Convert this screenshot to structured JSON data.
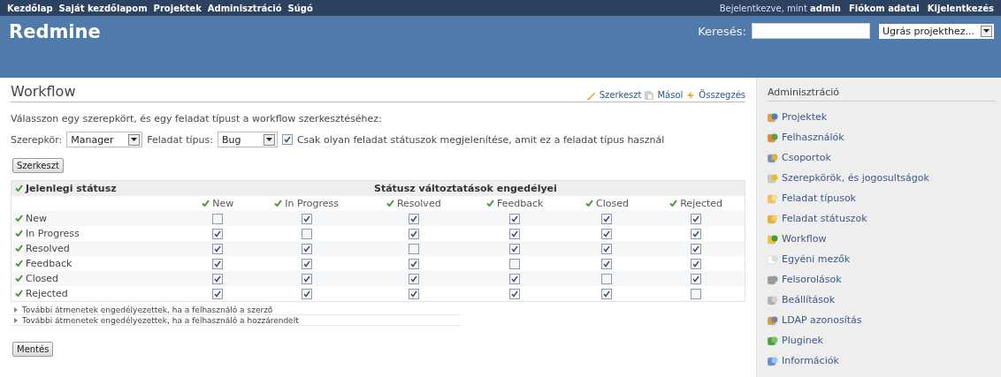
{
  "top_menu": {
    "items": [
      "Kezdőlap",
      "Saját kezdőlapom",
      "Projektek",
      "Adminisztráció",
      "Súgó"
    ],
    "logged_in": "Bejelentkezve, mint **admin**",
    "account_links": [
      "Fiókom adatai",
      "Kijelentkezés"
    ]
  },
  "header": {
    "title": "Redmine",
    "search_label": "Keresés:",
    "jump_select": "Ugrás projekthez..."
  },
  "content": {
    "title": "Workflow",
    "actions": [
      "Szerkeszt",
      "Másol",
      "Összegzés"
    ],
    "intro": "Válasszon egy szerepkört, és egy feladat típust a workflow szerkesztéséhez:",
    "role_label": "Szerepkör:",
    "role_value": "Manager",
    "tracker_label": "Feladat típus:",
    "tracker_value": "Bug",
    "used_only": {
      "label": "Csak olyan feladat státuszok megjelenítése, amit ez a feladat típus használ",
      "checked": true
    },
    "edit_button": "Szerkeszt",
    "table": {
      "current_header": "Jelenlegi státusz",
      "allowed_header": "Státusz változtatások engedélyei",
      "columns": [
        "New",
        "In Progress",
        "Resolved",
        "Feedback",
        "Closed",
        "Rejected"
      ],
      "rows": [
        {
          "status": "New",
          "cells": [
            false,
            true,
            true,
            true,
            true,
            true
          ]
        },
        {
          "status": "In Progress",
          "cells": [
            true,
            false,
            true,
            true,
            true,
            true
          ]
        },
        {
          "status": "Resolved",
          "cells": [
            true,
            true,
            false,
            true,
            true,
            true
          ]
        },
        {
          "status": "Feedback",
          "cells": [
            true,
            true,
            true,
            false,
            true,
            true
          ]
        },
        {
          "status": "Closed",
          "cells": [
            true,
            true,
            true,
            true,
            false,
            true
          ]
        },
        {
          "status": "Rejected",
          "cells": [
            true,
            true,
            true,
            true,
            true,
            false
          ]
        }
      ]
    },
    "collapsed_sections": [
      {
        "label": "További átmenetek engedélyezettek, ha a felhasználó a szerző",
        "expanded": false
      },
      {
        "label": "További átmenetek engedélyezettek, ha a felhasználó a hozzárendelt",
        "expanded": false
      }
    ],
    "save_button": "Mentés"
  },
  "sidebar": {
    "title": "Adminisztráció",
    "items": [
      "Projektek",
      "Felhasználók",
      "Csoportok",
      "Szerepkörök, és jogosultságok",
      "Feladat típusok",
      "Feladat státuszok",
      "Workflow",
      "Egyéni mezők",
      "Felsorolások",
      "Beállítások",
      "LDAP azonosítás",
      "Pluginek",
      "Információk"
    ]
  }
}
